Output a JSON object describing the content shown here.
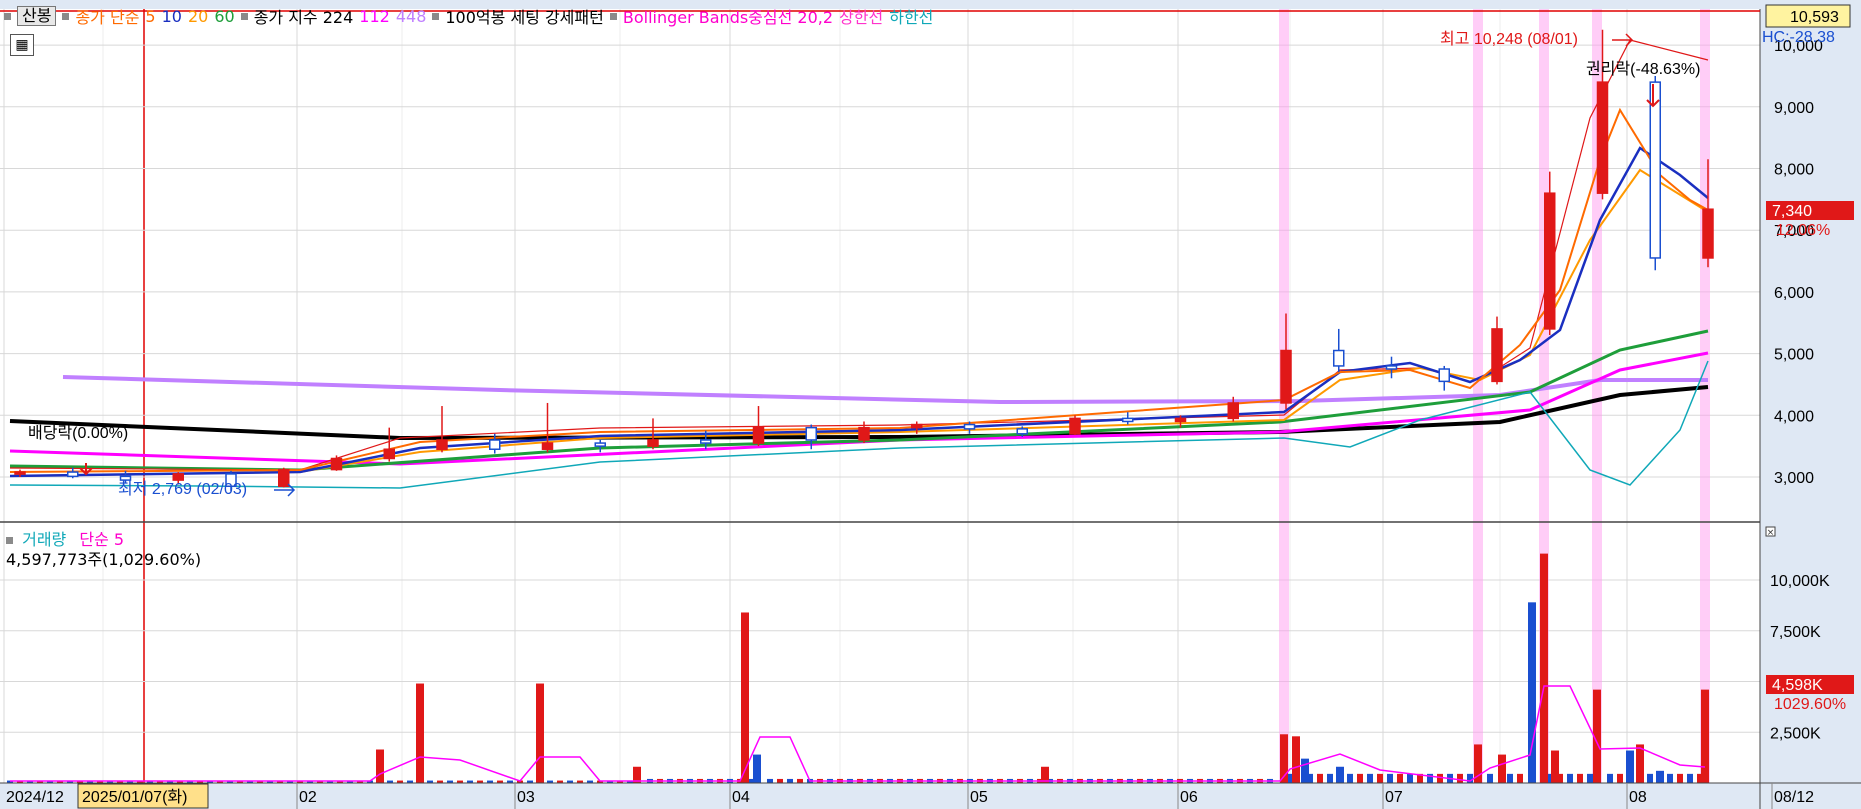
{
  "legend": {
    "candle_btn": "산봉",
    "ma_label": "종가 단순",
    "ma_periods": [
      "5",
      "10",
      "20",
      "60"
    ],
    "ma_colors": [
      "#ff6a00",
      "#1a2fc0",
      "#ff9900",
      "#1e9e3a"
    ],
    "index_label": "종가 지수 224",
    "index_periods": [
      "112",
      "448"
    ],
    "index_colors": [
      "#ff00ff",
      "#c080ff"
    ],
    "pattern_label": "100억봉 세팅 강세패턴",
    "bb_label": "Bollinger Bands중심선 20,2",
    "bb_upper": "상한선",
    "bb_lower": "하한선",
    "bb_colors": [
      "#ff00cc",
      "#ff33cc",
      "#10a8b8"
    ],
    "grid_btn": "▦"
  },
  "price_axis_labels": [
    "10,000",
    "9,000",
    "8,000",
    "7,000",
    "6,000",
    "5,000",
    "4,000",
    "3,000"
  ],
  "price_boxes": {
    "top_value": "10,593",
    "hc": "HC:-28.38",
    "current": "7,340",
    "change": "12.06%"
  },
  "annotations": {
    "high": "최고 10,248 (08/01)",
    "low": "최저 2,769 (02/03)",
    "dividend": "배당락(0.00%)",
    "rights": "권리락(-48.63%)"
  },
  "volume": {
    "legend_label": "거래량",
    "legend_ma": "단순 5",
    "info": "4,597,773주(1,029.60%)",
    "axis_labels": [
      "10,000K",
      "7,500K",
      "5,000K",
      "2,500K"
    ],
    "current": "4,598K",
    "ratio": "1029.60%"
  },
  "x_axis": {
    "labels": [
      "2024/12",
      "02",
      "03",
      "04",
      "05",
      "06",
      "07",
      "08",
      "08/12"
    ],
    "selected_date": "2025/01/07(화)"
  },
  "chart_data": {
    "type": "candlestick",
    "y_range": [
      2300,
      10650
    ],
    "volume_range_k": [
      0,
      12500
    ],
    "x_axis_months": [
      "2024/12",
      "02",
      "03",
      "04",
      "05",
      "06",
      "07",
      "08"
    ],
    "candles": [
      {
        "d": "01/06",
        "o": 3050,
        "h": 3120,
        "l": 3000,
        "c": 3080
      },
      {
        "d": "01/13",
        "o": 3080,
        "h": 3150,
        "l": 2980,
        "c": 3010
      },
      {
        "d": "01/20",
        "o": 3010,
        "h": 3100,
        "l": 2900,
        "c": 2950
      },
      {
        "d": "01/27",
        "o": 2950,
        "h": 3080,
        "l": 2880,
        "c": 3050
      },
      {
        "d": "02/03",
        "o": 3050,
        "h": 3100,
        "l": 2769,
        "c": 2850
      },
      {
        "d": "02/10",
        "o": 2850,
        "h": 3150,
        "l": 2830,
        "c": 3120
      },
      {
        "d": "02/17",
        "o": 3120,
        "h": 3350,
        "l": 3100,
        "c": 3300
      },
      {
        "d": "02/24",
        "o": 3300,
        "h": 3800,
        "l": 3250,
        "c": 3450
      },
      {
        "d": "03/03",
        "o": 3450,
        "h": 4150,
        "l": 3400,
        "c": 3600
      },
      {
        "d": "03/10",
        "o": 3600,
        "h": 3700,
        "l": 3380,
        "c": 3450
      },
      {
        "d": "03/17",
        "o": 3450,
        "h": 4200,
        "l": 3400,
        "c": 3550
      },
      {
        "d": "03/24",
        "o": 3550,
        "h": 3600,
        "l": 3400,
        "c": 3500
      },
      {
        "d": "03/31",
        "o": 3500,
        "h": 3950,
        "l": 3450,
        "c": 3600
      },
      {
        "d": "04/07",
        "o": 3600,
        "h": 3750,
        "l": 3450,
        "c": 3550
      },
      {
        "d": "04/14",
        "o": 3550,
        "h": 4150,
        "l": 3500,
        "c": 3800
      },
      {
        "d": "04/21",
        "o": 3800,
        "h": 3850,
        "l": 3450,
        "c": 3600
      },
      {
        "d": "04/28",
        "o": 3600,
        "h": 3900,
        "l": 3550,
        "c": 3800
      },
      {
        "d": "05/05",
        "o": 3800,
        "h": 3900,
        "l": 3700,
        "c": 3850
      },
      {
        "d": "05/12",
        "o": 3850,
        "h": 3900,
        "l": 3700,
        "c": 3780
      },
      {
        "d": "05/19",
        "o": 3780,
        "h": 3820,
        "l": 3650,
        "c": 3700
      },
      {
        "d": "05/26",
        "o": 3700,
        "h": 4000,
        "l": 3680,
        "c": 3950
      },
      {
        "d": "06/02",
        "o": 3950,
        "h": 4050,
        "l": 3850,
        "c": 3900
      },
      {
        "d": "06/09",
        "o": 3900,
        "h": 4000,
        "l": 3800,
        "c": 3950
      },
      {
        "d": "06/16",
        "o": 3950,
        "h": 4300,
        "l": 3900,
        "c": 4200
      },
      {
        "d": "06/23",
        "o": 4200,
        "h": 5650,
        "l": 4100,
        "c": 5050
      },
      {
        "d": "06/30",
        "o": 5050,
        "h": 5400,
        "l": 4700,
        "c": 4800
      },
      {
        "d": "07/07",
        "o": 4800,
        "h": 4950,
        "l": 4600,
        "c": 4750
      },
      {
        "d": "07/14",
        "o": 4750,
        "h": 4800,
        "l": 4400,
        "c": 4550
      },
      {
        "d": "07/21",
        "o": 4550,
        "h": 5600,
        "l": 4500,
        "c": 5400
      },
      {
        "d": "07/28",
        "o": 5400,
        "h": 7950,
        "l": 5300,
        "c": 7600
      },
      {
        "d": "08/04",
        "o": 7600,
        "h": 10248,
        "l": 7500,
        "c": 9400
      },
      {
        "d": "08/11",
        "o": 9400,
        "h": 9500,
        "l": 6350,
        "c": 6550
      },
      {
        "d": "08/12",
        "o": 6550,
        "h": 8150,
        "l": 6400,
        "c": 7340
      }
    ]
  }
}
